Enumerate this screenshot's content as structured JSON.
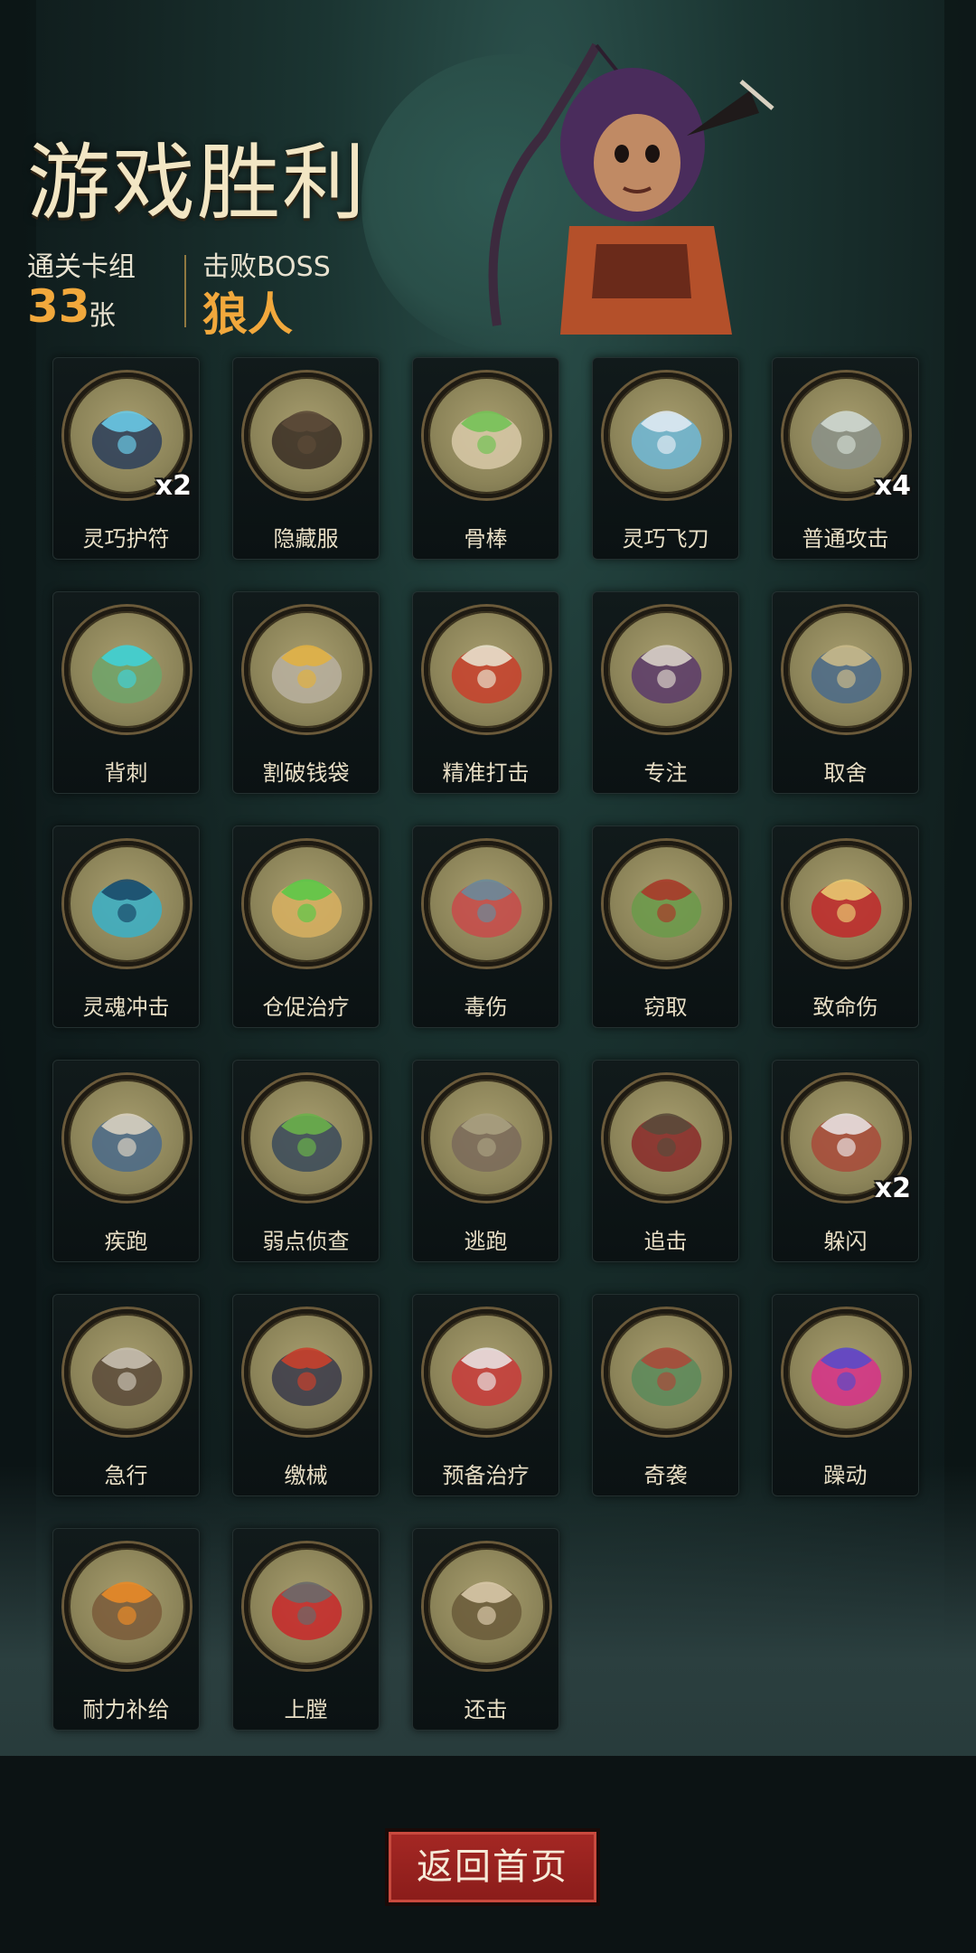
{
  "header": {
    "title": "游戏胜利",
    "deck_label": "通关卡组",
    "deck_count": "33",
    "deck_unit": "张",
    "boss_label": "击败BOSS",
    "boss_name": "狼人"
  },
  "cards": [
    {
      "label": "灵巧护符",
      "count": "x2",
      "icon": "amulet-icon"
    },
    {
      "label": "隐藏服",
      "count": "",
      "icon": "hooded-cloak-icon"
    },
    {
      "label": "骨棒",
      "count": "",
      "icon": "bone-club-icon"
    },
    {
      "label": "灵巧飞刀",
      "count": "",
      "icon": "flying-knives-icon"
    },
    {
      "label": "普通攻击",
      "count": "x4",
      "icon": "claw-blades-icon"
    },
    {
      "label": "背刺",
      "count": "",
      "icon": "backstab-icon"
    },
    {
      "label": "割破钱袋",
      "count": "",
      "icon": "cut-purse-icon"
    },
    {
      "label": "精准打击",
      "count": "",
      "icon": "target-icon"
    },
    {
      "label": "专注",
      "count": "",
      "icon": "wizard-icon"
    },
    {
      "label": "取舍",
      "count": "",
      "icon": "sage-icon"
    },
    {
      "label": "灵魂冲击",
      "count": "",
      "icon": "soul-blast-icon"
    },
    {
      "label": "仓促治疗",
      "count": "",
      "icon": "healing-scroll-icon"
    },
    {
      "label": "毒伤",
      "count": "",
      "icon": "poison-tentacle-icon"
    },
    {
      "label": "窃取",
      "count": "",
      "icon": "goblin-thief-icon"
    },
    {
      "label": "致命伤",
      "count": "",
      "icon": "fatal-dagger-icon"
    },
    {
      "label": "疾跑",
      "count": "",
      "icon": "sprint-icon"
    },
    {
      "label": "弱点侦查",
      "count": "",
      "icon": "wolf-icon"
    },
    {
      "label": "逃跑",
      "count": "",
      "icon": "flee-icon"
    },
    {
      "label": "追击",
      "count": "",
      "icon": "pursuit-icon"
    },
    {
      "label": "躲闪",
      "count": "x2",
      "icon": "dodge-icon"
    },
    {
      "label": "急行",
      "count": "",
      "icon": "rush-icon"
    },
    {
      "label": "缴械",
      "count": "",
      "icon": "disarm-icon"
    },
    {
      "label": "预备治疗",
      "count": "",
      "icon": "heart-heal-icon"
    },
    {
      "label": "奇袭",
      "count": "",
      "icon": "ambush-icon"
    },
    {
      "label": "躁动",
      "count": "",
      "icon": "frenzy-icon"
    },
    {
      "label": "耐力补给",
      "count": "",
      "icon": "stamina-potion-icon"
    },
    {
      "label": "上膛",
      "count": "",
      "icon": "crossbow-icon"
    },
    {
      "label": "还击",
      "count": "",
      "icon": "counterattack-icon"
    }
  ],
  "footer": {
    "home_button": "返回首页"
  },
  "colors": {
    "accent_orange": "#f1a83c",
    "button_red": "#a52824",
    "token_base": "#8c8459"
  }
}
